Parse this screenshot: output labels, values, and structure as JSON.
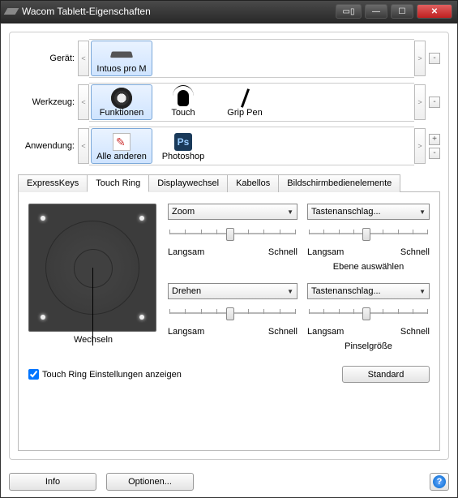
{
  "window": {
    "title": "Wacom Tablett-Eigenschaften"
  },
  "pickers": {
    "device": {
      "label": "Gerät:",
      "items": [
        {
          "label": "Intuos pro M"
        }
      ]
    },
    "tool": {
      "label": "Werkzeug:",
      "items": [
        {
          "label": "Funktionen"
        },
        {
          "label": "Touch"
        },
        {
          "label": "Grip Pen"
        }
      ]
    },
    "app": {
      "label": "Anwendung:",
      "items": [
        {
          "label": "Alle anderen"
        },
        {
          "label": "Photoshop"
        }
      ]
    }
  },
  "tabs": [
    {
      "label": "ExpressKeys"
    },
    {
      "label": "Touch Ring"
    },
    {
      "label": "Displaywechsel"
    },
    {
      "label": "Kabellos"
    },
    {
      "label": "Bildschirmbedienelemente"
    }
  ],
  "active_tab": 1,
  "ring": {
    "center_label": "Wechseln"
  },
  "functions": {
    "tl": {
      "combo": "Zoom",
      "slow": "Langsam",
      "fast": "Schnell",
      "sub": "",
      "thumb": 45
    },
    "tr": {
      "combo": "Tastenanschlag...",
      "slow": "Langsam",
      "fast": "Schnell",
      "sub": "Ebene auswählen",
      "thumb": 45
    },
    "bl": {
      "combo": "Drehen",
      "slow": "Langsam",
      "fast": "Schnell",
      "sub": "",
      "thumb": 45
    },
    "br": {
      "combo": "Tastenanschlag...",
      "slow": "Langsam",
      "fast": "Schnell",
      "sub": "Pinselgröße",
      "thumb": 45
    }
  },
  "show_settings": {
    "label": "Touch Ring Einstellungen anzeigen",
    "checked": true
  },
  "buttons": {
    "standard": "Standard",
    "info": "Info",
    "options": "Optionen..."
  },
  "glyphs": {
    "ps": "Ps",
    "help": "?"
  }
}
